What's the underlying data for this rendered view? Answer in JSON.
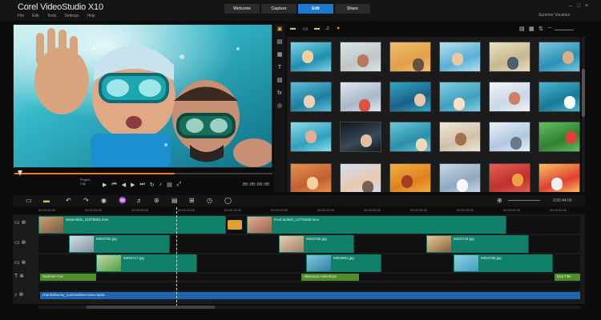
{
  "app": {
    "title": "Corel VideoStudio X10",
    "menu": [
      "File",
      "Edit",
      "Tools",
      "Settings",
      "Help"
    ],
    "tabs": [
      "Welcome",
      "Capture",
      "Edit",
      "Share"
    ],
    "active_tab": "Edit",
    "project_label": "Summer Vacation"
  },
  "player": {
    "mode_label_1": "Project",
    "mode_label_2": "Clip",
    "timecode": "00:00:00:00",
    "progress": 0.62
  },
  "timeline": {
    "ruler": [
      "00:00:00:00",
      "00:00:04:00",
      "00:00:08:00",
      "00:00:12:00",
      "00:00:16:00",
      "00:00:20:00",
      "00:00:24:00",
      "00:00:28:00",
      "00:00:32:00",
      "00:00:36:00",
      "00:00:40:00",
      "00:00:44:00"
    ],
    "video_clips": [
      {
        "label": "Waterslide_21079001.mov"
      },
      {
        "label": "Pool Splash_11776400.mov"
      }
    ],
    "overlay1_clips": [
      {
        "label": "IMG0782.jpg"
      },
      {
        "label": "IMG0755.jpg"
      },
      {
        "label": "IMG0733.jpg"
      }
    ],
    "overlay2_clips": [
      {
        "label": "IMG0717.jpg"
      },
      {
        "label": "IMG0801.jpg"
      },
      {
        "label": "IMG0758.jpg"
      }
    ],
    "title_clips": [
      {
        "label": "Summer Fun"
      },
      {
        "label": "Afternoon Adventure"
      },
      {
        "label": "End Title"
      }
    ],
    "audio_clips": [
      {
        "label": "chanfullsunny_summertime-tune.mp4a"
      }
    ],
    "zoom_timecode": "0:00:44:00"
  }
}
